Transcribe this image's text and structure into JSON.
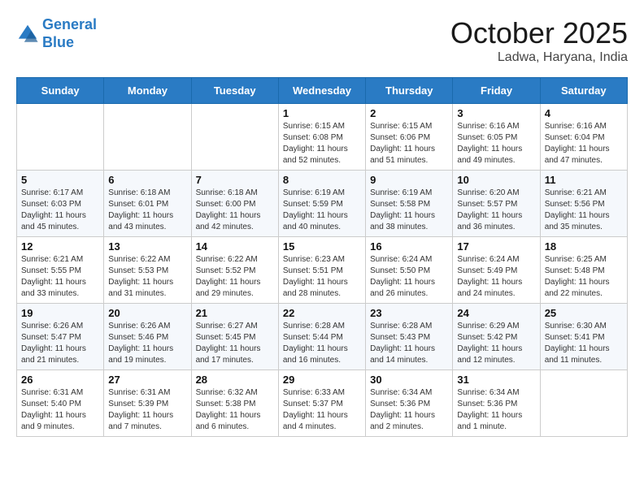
{
  "header": {
    "logo_line1": "General",
    "logo_line2": "Blue",
    "month": "October 2025",
    "location": "Ladwa, Haryana, India"
  },
  "weekdays": [
    "Sunday",
    "Monday",
    "Tuesday",
    "Wednesday",
    "Thursday",
    "Friday",
    "Saturday"
  ],
  "weeks": [
    [
      {
        "day": "",
        "info": ""
      },
      {
        "day": "",
        "info": ""
      },
      {
        "day": "",
        "info": ""
      },
      {
        "day": "1",
        "info": "Sunrise: 6:15 AM\nSunset: 6:08 PM\nDaylight: 11 hours\nand 52 minutes."
      },
      {
        "day": "2",
        "info": "Sunrise: 6:15 AM\nSunset: 6:06 PM\nDaylight: 11 hours\nand 51 minutes."
      },
      {
        "day": "3",
        "info": "Sunrise: 6:16 AM\nSunset: 6:05 PM\nDaylight: 11 hours\nand 49 minutes."
      },
      {
        "day": "4",
        "info": "Sunrise: 6:16 AM\nSunset: 6:04 PM\nDaylight: 11 hours\nand 47 minutes."
      }
    ],
    [
      {
        "day": "5",
        "info": "Sunrise: 6:17 AM\nSunset: 6:03 PM\nDaylight: 11 hours\nand 45 minutes."
      },
      {
        "day": "6",
        "info": "Sunrise: 6:18 AM\nSunset: 6:01 PM\nDaylight: 11 hours\nand 43 minutes."
      },
      {
        "day": "7",
        "info": "Sunrise: 6:18 AM\nSunset: 6:00 PM\nDaylight: 11 hours\nand 42 minutes."
      },
      {
        "day": "8",
        "info": "Sunrise: 6:19 AM\nSunset: 5:59 PM\nDaylight: 11 hours\nand 40 minutes."
      },
      {
        "day": "9",
        "info": "Sunrise: 6:19 AM\nSunset: 5:58 PM\nDaylight: 11 hours\nand 38 minutes."
      },
      {
        "day": "10",
        "info": "Sunrise: 6:20 AM\nSunset: 5:57 PM\nDaylight: 11 hours\nand 36 minutes."
      },
      {
        "day": "11",
        "info": "Sunrise: 6:21 AM\nSunset: 5:56 PM\nDaylight: 11 hours\nand 35 minutes."
      }
    ],
    [
      {
        "day": "12",
        "info": "Sunrise: 6:21 AM\nSunset: 5:55 PM\nDaylight: 11 hours\nand 33 minutes."
      },
      {
        "day": "13",
        "info": "Sunrise: 6:22 AM\nSunset: 5:53 PM\nDaylight: 11 hours\nand 31 minutes."
      },
      {
        "day": "14",
        "info": "Sunrise: 6:22 AM\nSunset: 5:52 PM\nDaylight: 11 hours\nand 29 minutes."
      },
      {
        "day": "15",
        "info": "Sunrise: 6:23 AM\nSunset: 5:51 PM\nDaylight: 11 hours\nand 28 minutes."
      },
      {
        "day": "16",
        "info": "Sunrise: 6:24 AM\nSunset: 5:50 PM\nDaylight: 11 hours\nand 26 minutes."
      },
      {
        "day": "17",
        "info": "Sunrise: 6:24 AM\nSunset: 5:49 PM\nDaylight: 11 hours\nand 24 minutes."
      },
      {
        "day": "18",
        "info": "Sunrise: 6:25 AM\nSunset: 5:48 PM\nDaylight: 11 hours\nand 22 minutes."
      }
    ],
    [
      {
        "day": "19",
        "info": "Sunrise: 6:26 AM\nSunset: 5:47 PM\nDaylight: 11 hours\nand 21 minutes."
      },
      {
        "day": "20",
        "info": "Sunrise: 6:26 AM\nSunset: 5:46 PM\nDaylight: 11 hours\nand 19 minutes."
      },
      {
        "day": "21",
        "info": "Sunrise: 6:27 AM\nSunset: 5:45 PM\nDaylight: 11 hours\nand 17 minutes."
      },
      {
        "day": "22",
        "info": "Sunrise: 6:28 AM\nSunset: 5:44 PM\nDaylight: 11 hours\nand 16 minutes."
      },
      {
        "day": "23",
        "info": "Sunrise: 6:28 AM\nSunset: 5:43 PM\nDaylight: 11 hours\nand 14 minutes."
      },
      {
        "day": "24",
        "info": "Sunrise: 6:29 AM\nSunset: 5:42 PM\nDaylight: 11 hours\nand 12 minutes."
      },
      {
        "day": "25",
        "info": "Sunrise: 6:30 AM\nSunset: 5:41 PM\nDaylight: 11 hours\nand 11 minutes."
      }
    ],
    [
      {
        "day": "26",
        "info": "Sunrise: 6:31 AM\nSunset: 5:40 PM\nDaylight: 11 hours\nand 9 minutes."
      },
      {
        "day": "27",
        "info": "Sunrise: 6:31 AM\nSunset: 5:39 PM\nDaylight: 11 hours\nand 7 minutes."
      },
      {
        "day": "28",
        "info": "Sunrise: 6:32 AM\nSunset: 5:38 PM\nDaylight: 11 hours\nand 6 minutes."
      },
      {
        "day": "29",
        "info": "Sunrise: 6:33 AM\nSunset: 5:37 PM\nDaylight: 11 hours\nand 4 minutes."
      },
      {
        "day": "30",
        "info": "Sunrise: 6:34 AM\nSunset: 5:36 PM\nDaylight: 11 hours\nand 2 minutes."
      },
      {
        "day": "31",
        "info": "Sunrise: 6:34 AM\nSunset: 5:36 PM\nDaylight: 11 hours\nand 1 minute."
      },
      {
        "day": "",
        "info": ""
      }
    ]
  ]
}
